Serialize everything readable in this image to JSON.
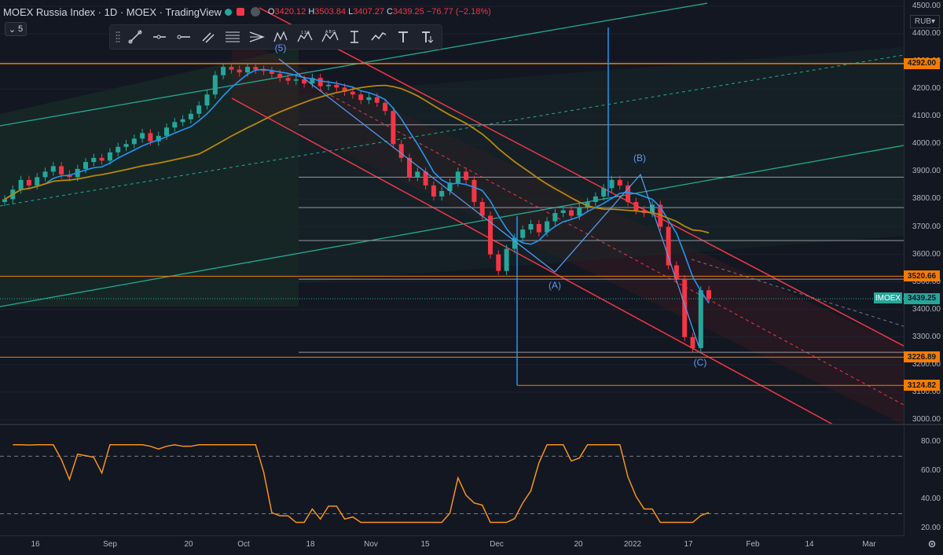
{
  "header": {
    "symbol_title": "MOEX Russia Index · 1D · MOEX · TradingView",
    "ohlc": {
      "o_label": "O",
      "o": "3420.12",
      "h_label": "H",
      "h": "3503.84",
      "l_label": "L",
      "l": "3407.27",
      "c_label": "C",
      "c": "3439.25",
      "change": "−76.77 (−2.18%)"
    },
    "collapse_count": "5"
  },
  "toolbar": {
    "icons": [
      "trend-line-icon",
      "horizontal-ray-icon",
      "horizontal-line-icon",
      "parallel-line-icon",
      "fib-retracement-icon",
      "pitchfork-icon",
      "xabcd-pattern-icon",
      "elliott-wave-icon",
      "abcd-pattern-icon",
      "anchored-text-icon",
      "path-icon",
      "text-icon",
      "text-note-icon"
    ],
    "wave_label_1": "1 3 5",
    "wave_label_2": "A B C"
  },
  "currency": "RUB",
  "price_axis": {
    "ticks": [
      "4500.00",
      "4400.00",
      "4300.00",
      "4200.00",
      "4100.00",
      "4000.00",
      "3900.00",
      "3800.00",
      "3700.00",
      "3600.00",
      "3500.00",
      "3400.00",
      "3300.00",
      "3200.00",
      "3100.00",
      "3000.00"
    ],
    "tags": [
      {
        "value": "4292.00",
        "price": 4292,
        "color": "#f57c00"
      },
      {
        "value": "3520.66",
        "price": 3520.66,
        "color": "#f57c00"
      },
      {
        "value": "3439.25",
        "price": 3439.25,
        "color": "#26a69a"
      },
      {
        "value": "3226.89",
        "price": 3226.89,
        "color": "#f57c00"
      },
      {
        "value": "3124.82",
        "price": 3124.82,
        "color": "#f57c00"
      }
    ],
    "ticker_tag": "IMOEX"
  },
  "rsi_axis": {
    "ticks": [
      "80.00",
      "60.00",
      "40.00",
      "20.00"
    ]
  },
  "time_axis": [
    "16",
    "Sep",
    "20",
    "Oct",
    "18",
    "Nov",
    "15",
    "Dec",
    "20",
    "2022",
    "17",
    "Feb",
    "14",
    "Mar"
  ],
  "wave_labels": {
    "five": "(5)",
    "a": "(A)",
    "b": "(B)",
    "c": "(C)"
  },
  "colors": {
    "up": "#26a69a",
    "down": "#f23645",
    "orange_level": "#f57c00",
    "channel_red": "#f23645",
    "channel_teal": "#22ab94",
    "ma_blue": "#2196f3",
    "ma_gold": "#b8860b",
    "rsi": "#f7931a",
    "wave": "#5b9cf6"
  },
  "chart_data": {
    "type": "candlestick",
    "ylim": [
      3000,
      4500
    ],
    "levels": {
      "orange": [
        4292,
        3520.66,
        3226.89
      ],
      "white": [
        4070,
        3880,
        3770,
        3650,
        3510,
        3245
      ],
      "fib_top": 3520.66,
      "fib_bottom": 3124.82
    },
    "candles_close": [
      3800,
      3835,
      3870,
      3850,
      3880,
      3900,
      3920,
      3890,
      3880,
      3910,
      3935,
      3950,
      3940,
      3970,
      3990,
      4000,
      4020,
      4040,
      4010,
      4030,
      4060,
      4080,
      4090,
      4110,
      4140,
      4180,
      4250,
      4280,
      4270,
      4260,
      4280,
      4270,
      4265,
      4255,
      4240,
      4230,
      4235,
      4220,
      4240,
      4210,
      4215,
      4205,
      4190,
      4180,
      4160,
      4170,
      4150,
      4120,
      4000,
      3950,
      3880,
      3900,
      3850,
      3810,
      3830,
      3860,
      3900,
      3870,
      3790,
      3740,
      3600,
      3540,
      3620,
      3660,
      3690,
      3710,
      3680,
      3720,
      3750,
      3760,
      3740,
      3770,
      3790,
      3810,
      3840,
      3870,
      3850,
      3790,
      3760,
      3750,
      3780,
      3700,
      3560,
      3510,
      3300,
      3260,
      3470,
      3439
    ]
  }
}
